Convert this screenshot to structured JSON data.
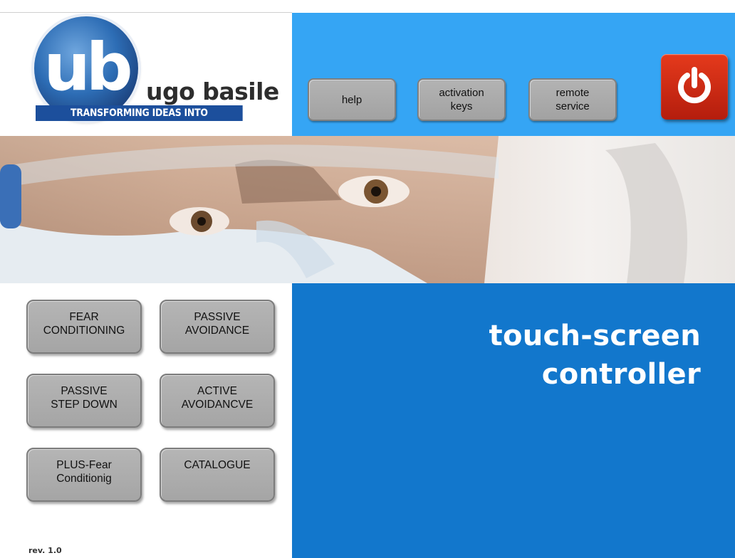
{
  "logo": {
    "monogram": "ub",
    "brand": "ugo basile",
    "tagline": "TRANSFORMING IDEAS INTO INSTRUMENTS"
  },
  "header": {
    "buttons": [
      {
        "label": "help"
      },
      {
        "label": "activation\nkeys"
      },
      {
        "label": "remote\nservice"
      }
    ],
    "power_icon": "power-icon"
  },
  "menu": {
    "buttons": [
      {
        "label": "FEAR\nCONDITIONING"
      },
      {
        "label": "PASSIVE\nAVOIDANCE"
      },
      {
        "label": "PASSIVE\nSTEP DOWN"
      },
      {
        "label": "ACTIVE\nAVOIDANCVE"
      },
      {
        "label": "PLUS-Fear\nConditionig"
      },
      {
        "label": "CATALOGUE"
      }
    ]
  },
  "headline": {
    "line1": "touch-screen",
    "line2": "controller"
  },
  "footer": {
    "revision": "rev. 1.0"
  },
  "colors": {
    "header_blue": "#35a5f4",
    "panel_blue": "#1277cc",
    "power_red": "#c82a14",
    "button_grey": "#aaaaaa"
  }
}
